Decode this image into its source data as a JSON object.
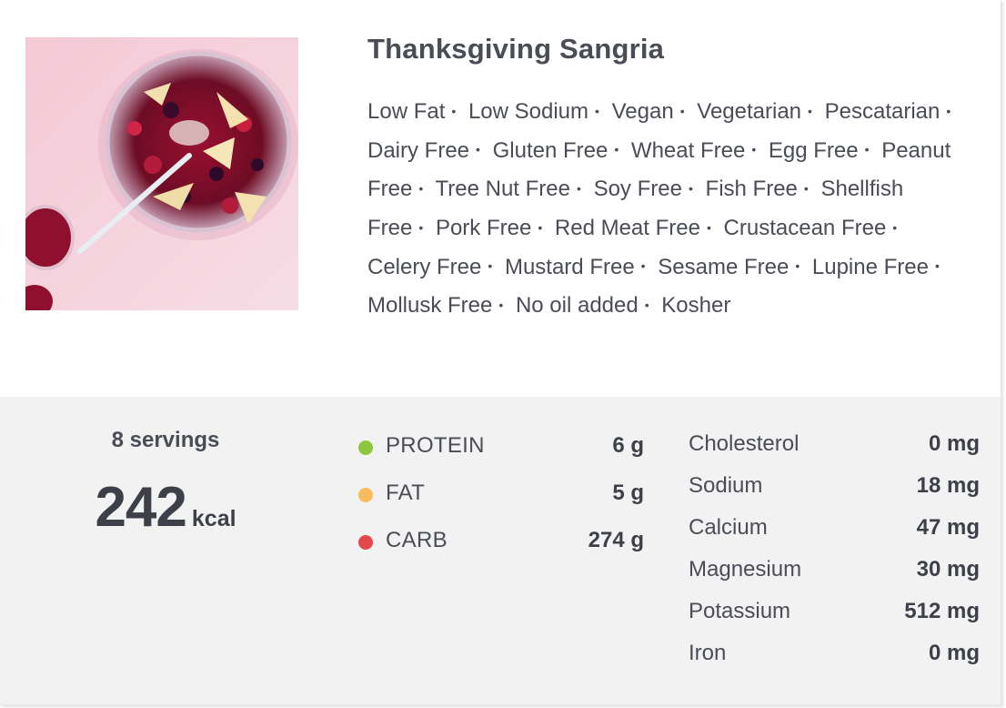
{
  "recipe": {
    "title": "Thanksgiving Sangria",
    "labels": [
      "Low Fat",
      "Low Sodium",
      "Vegan",
      "Vegetarian",
      "Pescatarian",
      "Dairy Free",
      "Gluten Free",
      "Wheat Free",
      "Egg Free",
      "Peanut Free",
      "Tree Nut Free",
      "Soy Free",
      "Fish Free",
      "Shellfish Free",
      "Pork Free",
      "Red Meat Free",
      "Crustacean Free",
      "Celery Free",
      "Mustard Free",
      "Sesame Free",
      "Lupine Free",
      "Mollusk Free",
      "No oil added",
      "Kosher"
    ],
    "separator": "•"
  },
  "summary": {
    "servings": "8 servings",
    "kcal_value": "242",
    "kcal_unit": "kcal"
  },
  "macros": [
    {
      "label": "PROTEIN",
      "value": "6 g",
      "color": "#8cc63f"
    },
    {
      "label": "FAT",
      "value": "5 g",
      "color": "#f7bd5d"
    },
    {
      "label": "CARB",
      "value": "274 g",
      "color": "#e4474d"
    }
  ],
  "minerals": [
    {
      "label": "Cholesterol",
      "value": "0 mg"
    },
    {
      "label": "Sodium",
      "value": "18 mg"
    },
    {
      "label": "Calcium",
      "value": "47 mg"
    },
    {
      "label": "Magnesium",
      "value": "30 mg"
    },
    {
      "label": "Potassium",
      "value": "512 mg"
    },
    {
      "label": "Iron",
      "value": "0 mg"
    }
  ]
}
